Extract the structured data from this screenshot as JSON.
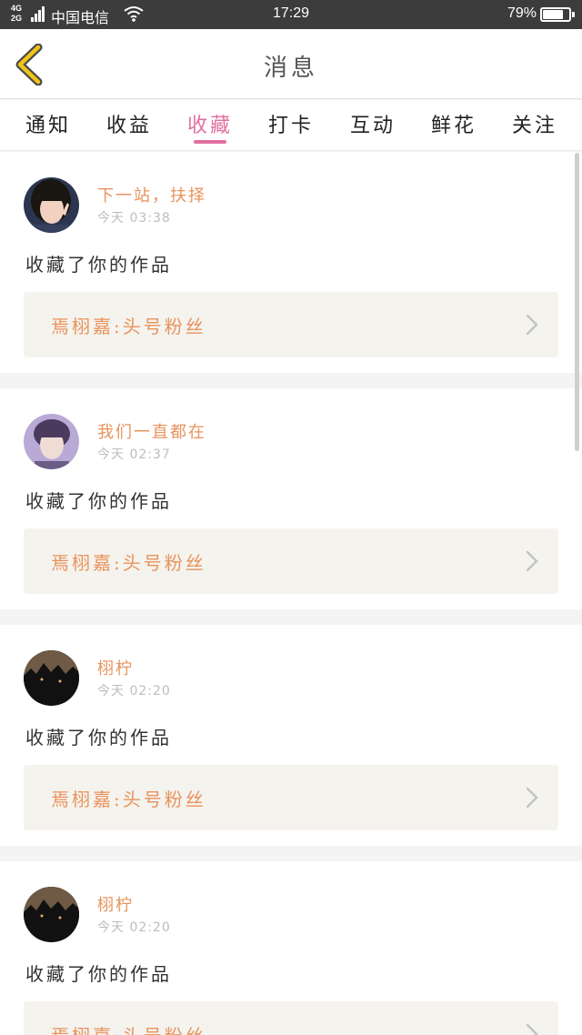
{
  "status_bar": {
    "network_top": "4G",
    "network_bottom": "2G",
    "carrier": "中国电信",
    "time": "17:29",
    "battery_percent": "79%",
    "battery_level": 0.79,
    "wifi_icon": "wifi-icon"
  },
  "header": {
    "title": "消息",
    "back_icon": "chevron-left-icon",
    "accent_color": "#f0c419"
  },
  "tabs": [
    {
      "label": "通知",
      "active": false
    },
    {
      "label": "收益",
      "active": false
    },
    {
      "label": "收藏",
      "active": true
    },
    {
      "label": "打卡",
      "active": false
    },
    {
      "label": "互动",
      "active": false
    },
    {
      "label": "鲜花",
      "active": false
    },
    {
      "label": "关注",
      "active": false
    }
  ],
  "colors": {
    "active_tab": "#e26fa1",
    "username": "#e8935c",
    "work_bg": "#f5f3ee"
  },
  "messages": [
    {
      "username": "下一站，扶择",
      "time": "今天 03:38",
      "action": "收藏了你的作品",
      "work_title": "焉栩嘉:头号粉丝"
    },
    {
      "username": "我们一直都在",
      "time": "今天 02:37",
      "action": "收藏了你的作品",
      "work_title": "焉栩嘉:头号粉丝"
    },
    {
      "username": "栩柠",
      "time": "今天 02:20",
      "action": "收藏了你的作品",
      "work_title": "焉栩嘉:头号粉丝"
    },
    {
      "username": "栩柠",
      "time": "今天 02:20",
      "action": "收藏了你的作品",
      "work_title": "焉栩嘉:头号粉丝"
    }
  ]
}
